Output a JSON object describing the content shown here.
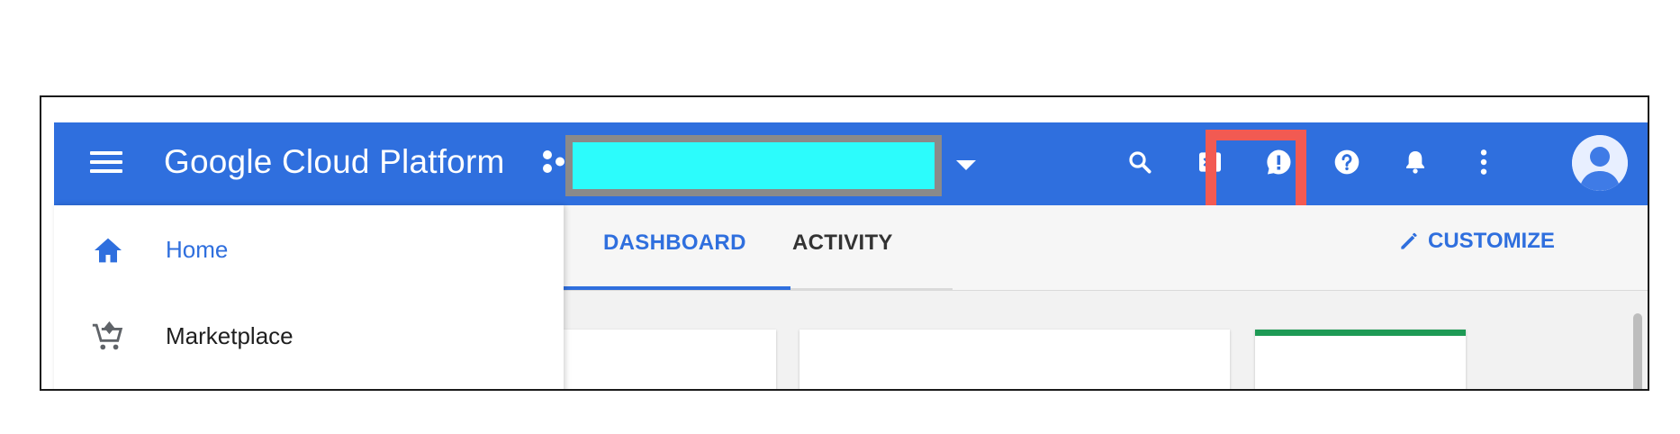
{
  "app": {
    "title": "Google Cloud Platform",
    "accent_color": "#2f6fde",
    "highlight_color": "#f25a52",
    "project_redaction_color": "#2cfcfc"
  },
  "topbar": {
    "menu_icon": "hamburger-menu-icon",
    "project_icon": "project-dots-icon",
    "project_caret_icon": "caret-down-icon",
    "actions": [
      {
        "name": "search",
        "icon": "search-icon"
      },
      {
        "name": "cloud-shell",
        "icon": "terminal-icon"
      },
      {
        "name": "feedback",
        "icon": "feedback-icon"
      },
      {
        "name": "help",
        "icon": "help-icon"
      },
      {
        "name": "notifications",
        "icon": "bell-icon"
      },
      {
        "name": "more",
        "icon": "more-vert-icon"
      },
      {
        "name": "account",
        "icon": "avatar-icon"
      }
    ]
  },
  "sidebar": {
    "items": [
      {
        "label": "Home",
        "icon": "home-icon",
        "active": true
      },
      {
        "label": "Marketplace",
        "icon": "cart-icon",
        "active": false
      }
    ]
  },
  "main": {
    "tabs": [
      {
        "label": "DASHBOARD",
        "active": true
      },
      {
        "label": "ACTIVITY",
        "active": false
      }
    ],
    "customize_label": "CUSTOMIZE",
    "customize_icon": "pencil-icon"
  }
}
